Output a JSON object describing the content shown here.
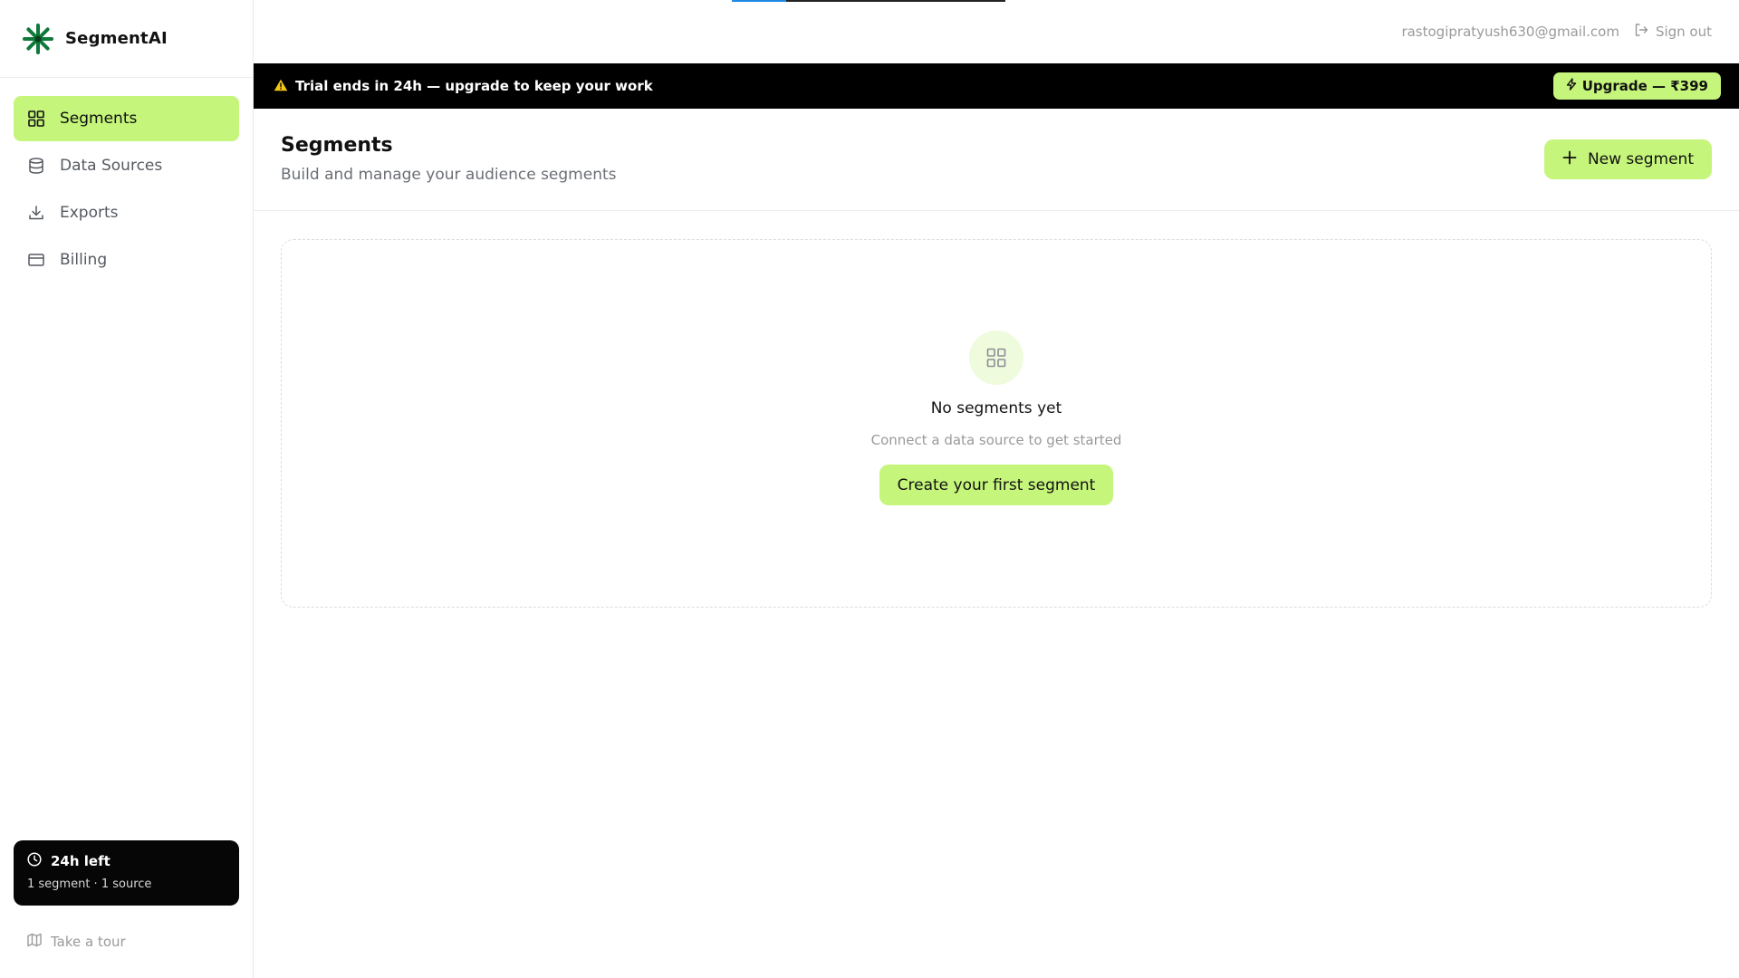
{
  "app": {
    "name": "SegmentAI"
  },
  "sidebar": {
    "items": [
      {
        "label": "Segments",
        "icon": "grid-icon",
        "active": true
      },
      {
        "label": "Data Sources",
        "icon": "database-icon",
        "active": false
      },
      {
        "label": "Exports",
        "icon": "download-icon",
        "active": false
      },
      {
        "label": "Billing",
        "icon": "credit-card-icon",
        "active": false
      }
    ],
    "trial": {
      "title": "24h left",
      "subtitle": "1 segment · 1 source",
      "icon": "clock-icon"
    },
    "tour": {
      "label": "Take a tour",
      "icon": "map-icon"
    }
  },
  "topbar": {
    "email": "rastogipratyush630@gmail.com",
    "signout_label": "Sign out",
    "loading_progress": 0.2
  },
  "banner": {
    "text": "Trial ends in 24h — upgrade to keep your work",
    "upgrade_label": "Upgrade — ₹399"
  },
  "page": {
    "title": "Segments",
    "subtitle": "Build and manage your audience segments",
    "new_button_label": "New segment"
  },
  "empty_state": {
    "title": "No segments yet",
    "subtitle": "Connect a data source to get started",
    "cta_label": "Create your first segment"
  },
  "colors": {
    "accent": "#c5f57a",
    "banner_bg": "#000000",
    "warning": "#f5c518",
    "brand_logo": "#0e7a3a"
  }
}
